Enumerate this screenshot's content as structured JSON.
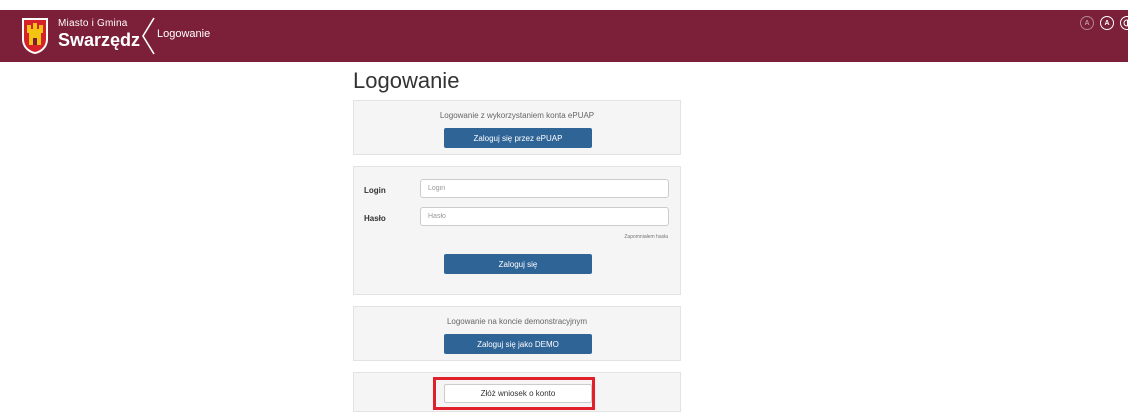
{
  "header": {
    "brand_small": "Miasto i Gmina",
    "brand_big": "Swarzędz",
    "crumb": "Logowanie",
    "bg_color": "#7b2038",
    "icons": [
      "coat-of-arms-icon",
      "chevron-left-icon",
      "font-smaller-icon",
      "font-larger-icon",
      "contrast-icon"
    ],
    "acc_small_label": "A",
    "acc_large_label": "A"
  },
  "main": {
    "title": "Logowanie",
    "epuap": {
      "caption": "Logowanie z wykorzystaniem konta ePUAP",
      "button": "Zaloguj się przez ePUAP"
    },
    "login_form": {
      "login_label": "Login",
      "login_placeholder": "Login",
      "password_label": "Hasło",
      "password_placeholder": "Hasło",
      "forgot": "Zapomniałem hasła",
      "submit": "Zaloguj się"
    },
    "demo": {
      "caption": "Logowanie na koncie demonstracyjnym",
      "button": "Zaloguj się jako DEMO"
    },
    "account_request": {
      "button": "Złóż wniosek o konto"
    },
    "primary_color": "#2f6497",
    "highlight_color": "#e0202a"
  }
}
